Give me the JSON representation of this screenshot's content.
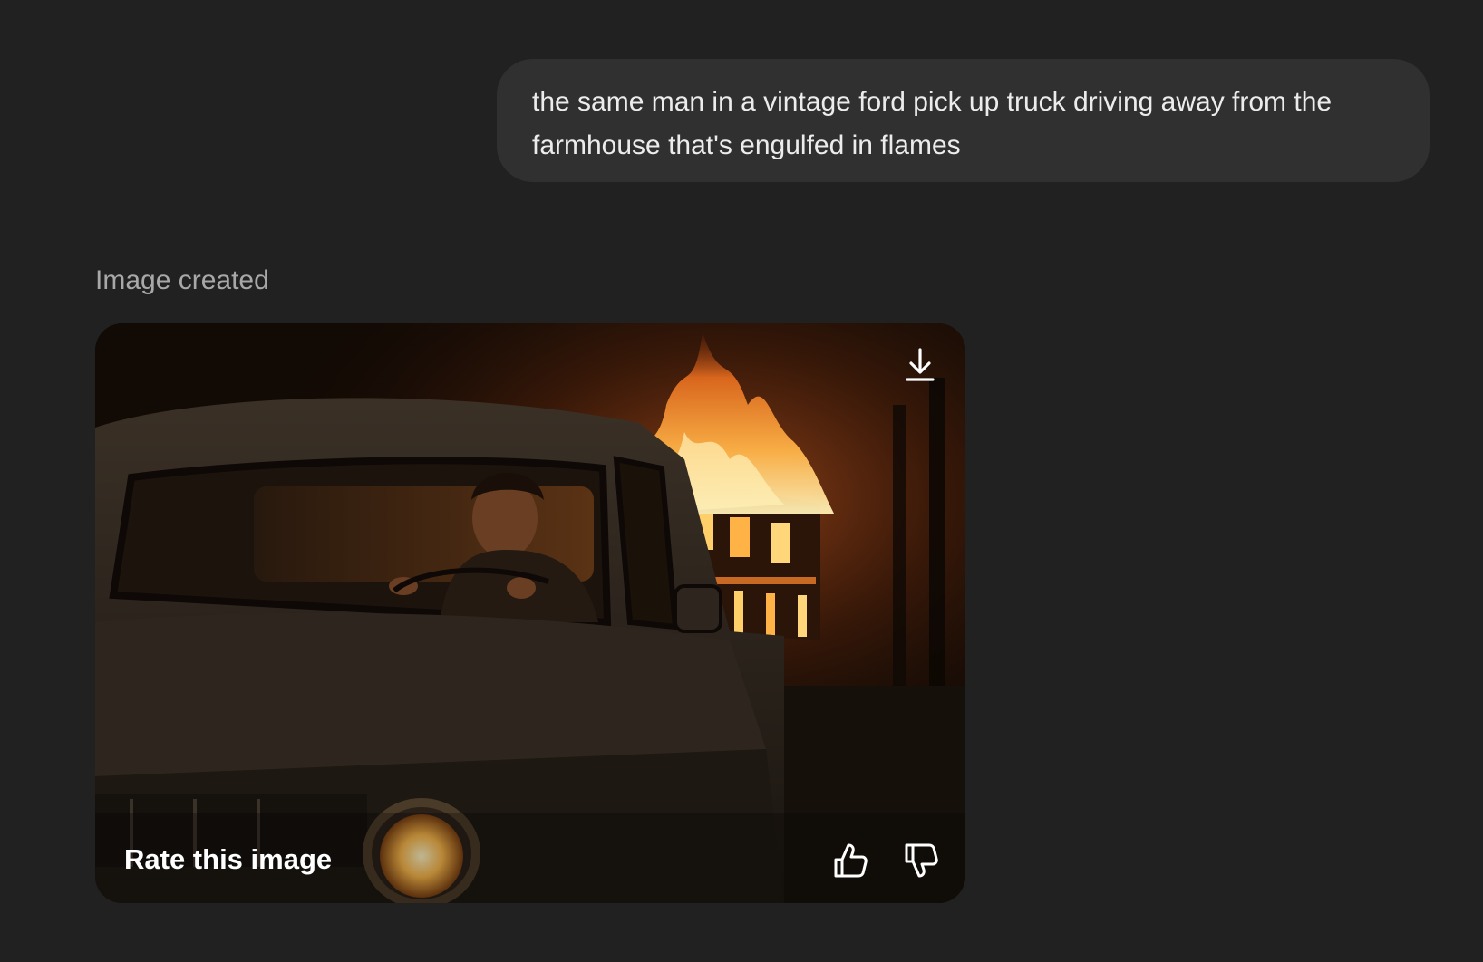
{
  "conversation": {
    "user_message": "the same man in a vintage ford pick up truck driving away from the farmhouse that's engulfed in flames",
    "assistant_status": "Image created"
  },
  "image_card": {
    "rate_label": "Rate this image",
    "icons": {
      "download": "download-icon",
      "thumbs_up": "thumbs-up-icon",
      "thumbs_down": "thumbs-down-icon"
    },
    "scene_colors": {
      "fire_core": "#fff1b8",
      "fire_mid": "#ff9a2e",
      "fire_outer": "#c8501a",
      "truck_body": "#2a241d",
      "sky": "#120a05"
    }
  },
  "colors": {
    "background": "#212121",
    "bubble": "#303030",
    "text": "#ececec",
    "muted_text": "#a8a8a8"
  }
}
